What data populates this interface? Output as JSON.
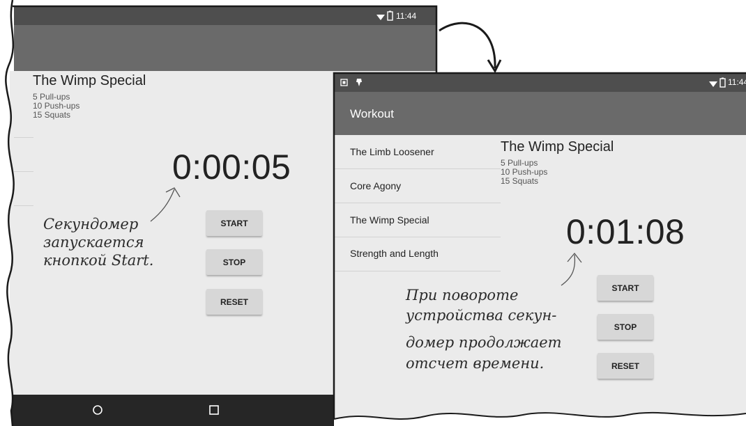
{
  "left_screen": {
    "status_time": "11:44",
    "workout": {
      "title": "The Wimp Special",
      "exercises": [
        "5 Pull-ups",
        "10 Push-ups",
        "15 Squats"
      ]
    },
    "timer": "0:00:05",
    "buttons": {
      "start": "START",
      "stop": "STOP",
      "reset": "RESET"
    },
    "annotation": [
      "Секундомер",
      "запускается",
      "кнопкой Start."
    ]
  },
  "right_screen": {
    "status_time": "11:44",
    "app_title": "Workout",
    "workout_list": [
      "The Limb Loosener",
      "Core Agony",
      "The Wimp Special",
      "Strength and Length"
    ],
    "workout": {
      "title": "The Wimp Special",
      "exercises": [
        "5 Pull-ups",
        "10 Push-ups",
        "15 Squats"
      ]
    },
    "timer": "0:01:08",
    "buttons": {
      "start": "START",
      "stop": "STOP",
      "reset": "RESET"
    },
    "annotation": [
      "При повороте",
      "устройства секун-",
      "домер продолжает",
      "отсчет времени."
    ]
  }
}
